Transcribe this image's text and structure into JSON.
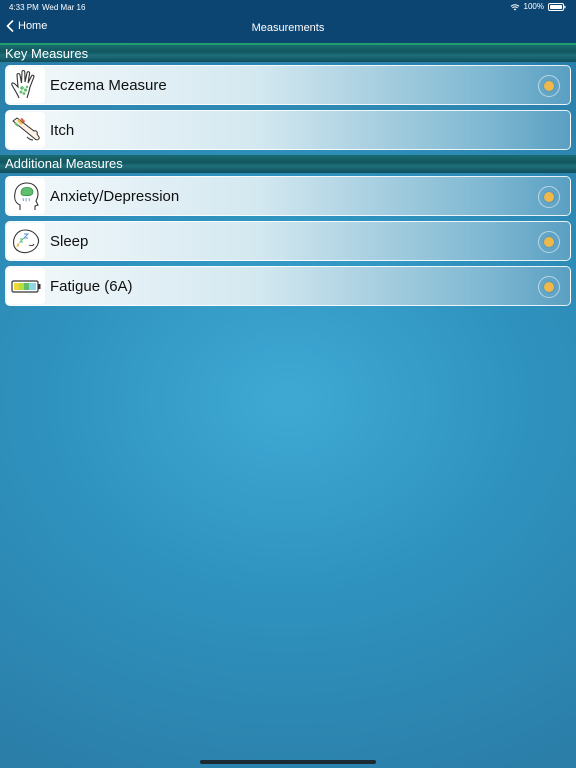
{
  "status": {
    "time": "4:33 PM",
    "date": "Wed Mar 16",
    "battery": "100%"
  },
  "nav": {
    "back_label": "Home",
    "title": "Measurements"
  },
  "sections": [
    {
      "title": "Key Measures",
      "items": [
        {
          "label": "Eczema Measure",
          "icon": "hand-icon",
          "has_indicator": true
        },
        {
          "label": "Itch",
          "icon": "scratching-arm-icon",
          "has_indicator": false
        }
      ]
    },
    {
      "title": "Additional Measures",
      "items": [
        {
          "label": "Anxiety/Depression",
          "icon": "head-brain-icon",
          "has_indicator": true
        },
        {
          "label": "Sleep",
          "icon": "sleep-face-icon",
          "has_indicator": true
        },
        {
          "label": "Fatigue (6A)",
          "icon": "battery-level-icon",
          "has_indicator": true
        }
      ]
    }
  ],
  "colors": {
    "nav_bg": "#0d4572",
    "indicator": "#f0b848",
    "section_accent": "#22a06b"
  }
}
